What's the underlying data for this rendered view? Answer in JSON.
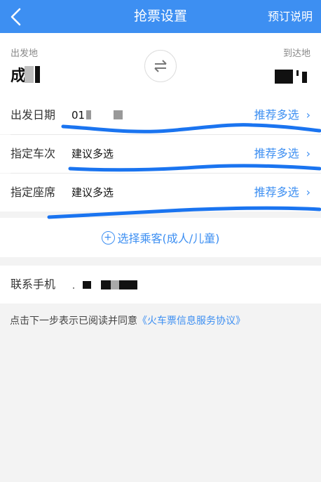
{
  "header": {
    "title": "抢票设置",
    "right_action": "预订说明"
  },
  "route": {
    "from_label": "出发地",
    "from_city": "成",
    "to_label": "到达地"
  },
  "rows": [
    {
      "label": "出发日期",
      "value": "01",
      "link": "推荐多选"
    },
    {
      "label": "指定车次",
      "value": "建议多选",
      "link": "推荐多选"
    },
    {
      "label": "指定座席",
      "value": "建议多选",
      "link": "推荐多选"
    }
  ],
  "passenger": {
    "text": "选择乘客(成人/儿童)"
  },
  "contact": {
    "label": "联系手机"
  },
  "agreement": {
    "prefix": "点击下一步表示已阅读并同意",
    "link": "《火车票信息服务协议》"
  },
  "colors": {
    "accent": "#3d8ff2",
    "scribble": "#1a74f0"
  },
  "icons": {
    "back": "chevron-left-icon",
    "swap": "swap-icon",
    "chevron": "chevron-right-icon",
    "add": "plus-circle-icon"
  }
}
